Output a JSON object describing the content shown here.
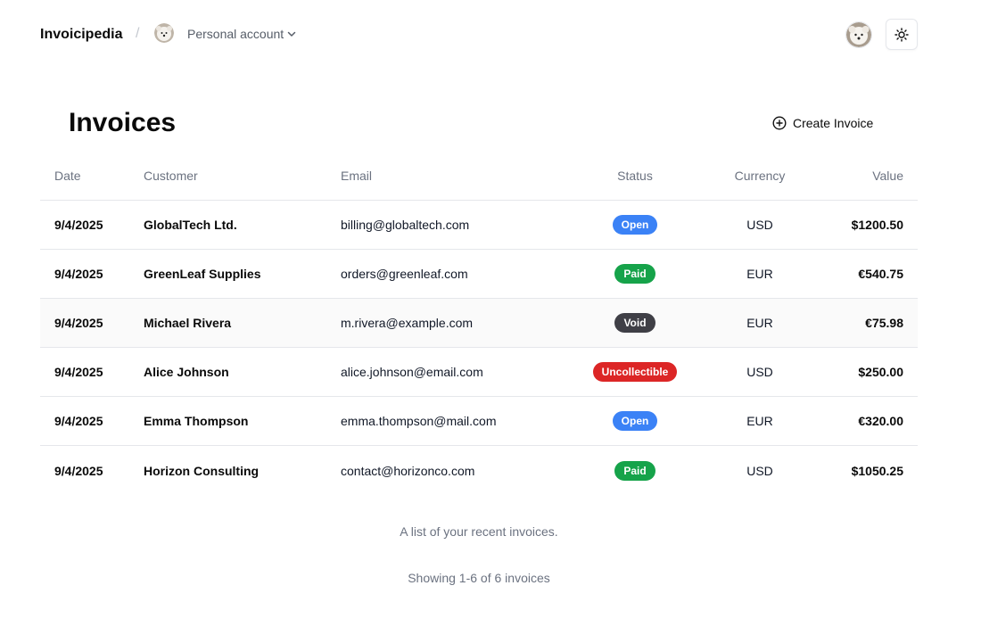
{
  "header": {
    "brand": "Invoicipedia",
    "separator": "/",
    "account_label": "Personal account"
  },
  "main": {
    "title": "Invoices",
    "create_label": "Create Invoice"
  },
  "table": {
    "columns": {
      "date": "Date",
      "customer": "Customer",
      "email": "Email",
      "status": "Status",
      "currency": "Currency",
      "value": "Value"
    },
    "rows": [
      {
        "date": "9/4/2025",
        "customer": "GlobalTech Ltd.",
        "email": "billing@globaltech.com",
        "status": "Open",
        "status_color": "#3b82f6",
        "currency": "USD",
        "value": "$1200.50"
      },
      {
        "date": "9/4/2025",
        "customer": "GreenLeaf Supplies",
        "email": "orders@greenleaf.com",
        "status": "Paid",
        "status_color": "#16a34a",
        "currency": "EUR",
        "value": "€540.75"
      },
      {
        "date": "9/4/2025",
        "customer": "Michael Rivera",
        "email": "m.rivera@example.com",
        "status": "Void",
        "status_color": "#3f3f46",
        "currency": "EUR",
        "value": "€75.98"
      },
      {
        "date": "9/4/2025",
        "customer": "Alice Johnson",
        "email": "alice.johnson@email.com",
        "status": "Uncollectible",
        "status_color": "#dc2626",
        "currency": "USD",
        "value": "$250.00"
      },
      {
        "date": "9/4/2025",
        "customer": "Emma Thompson",
        "email": "emma.thompson@mail.com",
        "status": "Open",
        "status_color": "#3b82f6",
        "currency": "EUR",
        "value": "€320.00"
      },
      {
        "date": "9/4/2025",
        "customer": "Horizon Consulting",
        "email": "contact@horizonco.com",
        "status": "Paid",
        "status_color": "#16a34a",
        "currency": "USD",
        "value": "$1050.25"
      }
    ],
    "caption": "A list of your recent invoices.",
    "paging": "Showing 1-6 of 6 invoices"
  },
  "icons": {
    "account_avatar": "dog-avatar-icon",
    "chevron": "chevron-down-icon",
    "user_avatar": "dog-avatar-icon",
    "theme": "sun-icon",
    "create": "plus-circle-icon"
  }
}
